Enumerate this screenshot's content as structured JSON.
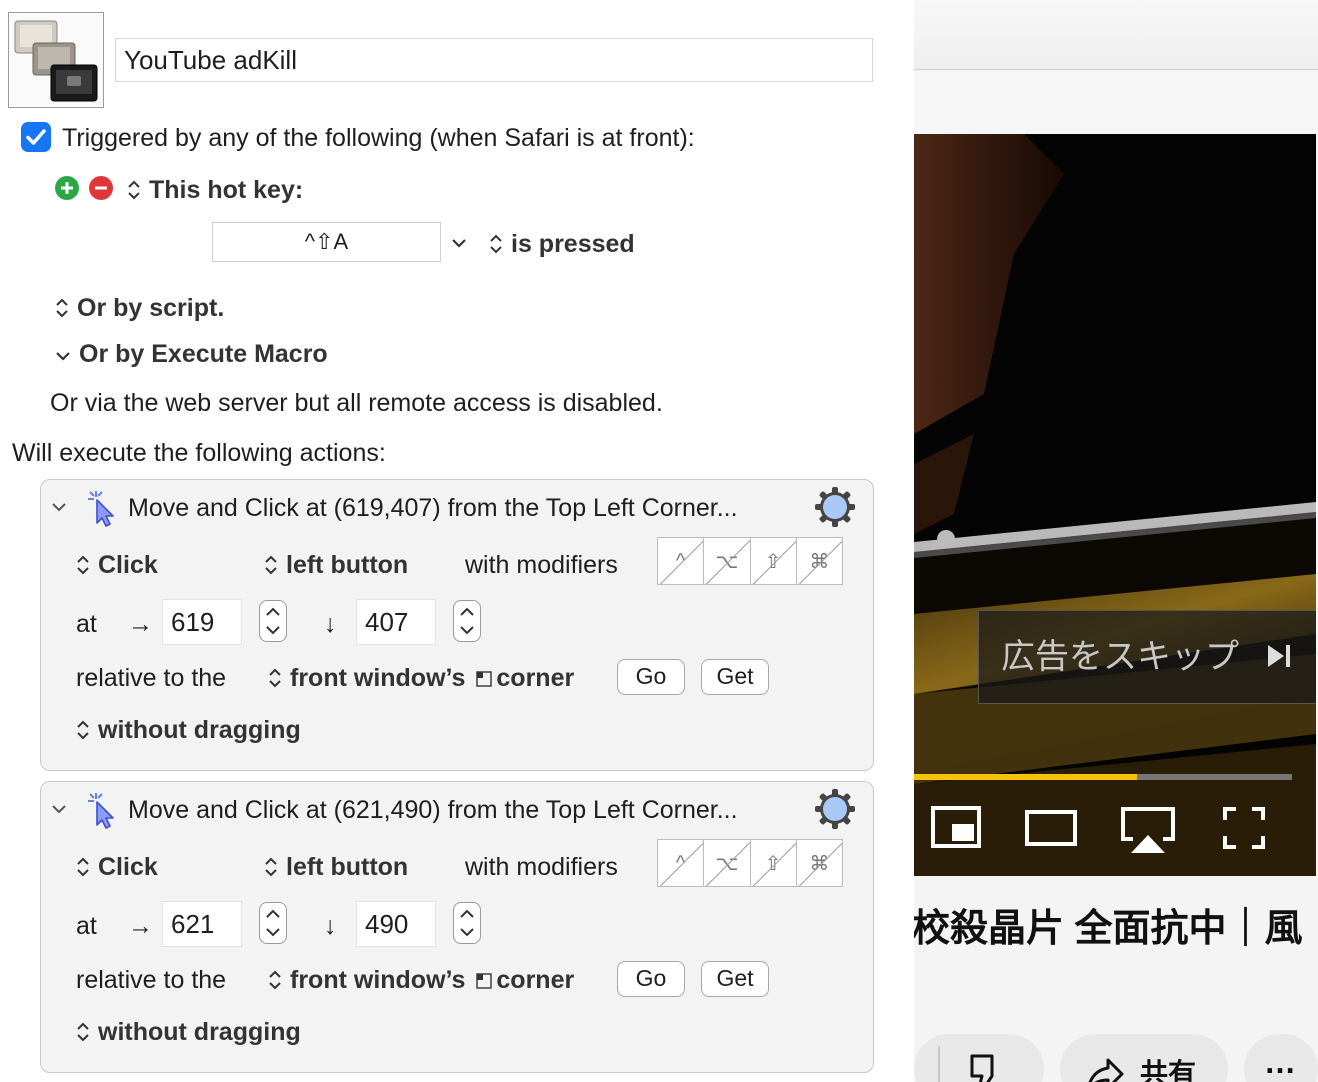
{
  "macro": {
    "name": "YouTube adKill"
  },
  "triggers": {
    "header": "Triggered by any of the following (when Safari is at front):",
    "hotkey_label": "This hot key:",
    "hotkey_value": "^⇧A",
    "hotkey_condition": "is pressed",
    "or_script": "Or by script.",
    "or_execute_macro": "Or by Execute Macro",
    "web_server_note": "Or via the web server but all remote access is disabled."
  },
  "actions_header": "Will execute the following actions:",
  "actions": [
    {
      "title": "Move and Click at (619,407) from the Top Left Corner...",
      "click_type": "Click",
      "button": "left button",
      "with_modifiers": "with modifiers",
      "modifiers": [
        "^",
        "⌥",
        "⇧",
        "⌘"
      ],
      "at_label": "at",
      "x_arrow": "→",
      "x": "619",
      "y_arrow": "↓",
      "y": "407",
      "relative_label": "relative to the",
      "relative_prefix": "front window’s",
      "relative_suffix": "corner",
      "go_label": "Go",
      "get_label": "Get",
      "drag": "without dragging"
    },
    {
      "title": "Move and Click at (621,490) from the Top Left Corner...",
      "click_type": "Click",
      "button": "left button",
      "with_modifiers": "with modifiers",
      "modifiers": [
        "^",
        "⌥",
        "⇧",
        "⌘"
      ],
      "at_label": "at",
      "x_arrow": "→",
      "x": "621",
      "y_arrow": "↓",
      "y": "490",
      "relative_label": "relative to the",
      "relative_prefix": "front window’s",
      "relative_suffix": "corner",
      "go_label": "Go",
      "get_label": "Get",
      "drag": "without dragging"
    }
  ],
  "browser": {
    "skip_ad_label": "広告をスキップ",
    "video_progress": 0.59,
    "video_title": "校殺晶片 全面抗中｜風",
    "share_label": "共有",
    "more_label": "…",
    "colors": {
      "progress": "#f6c20a",
      "checkbox": "#1676f3",
      "add": "#28a745",
      "remove": "#e0353b"
    }
  }
}
